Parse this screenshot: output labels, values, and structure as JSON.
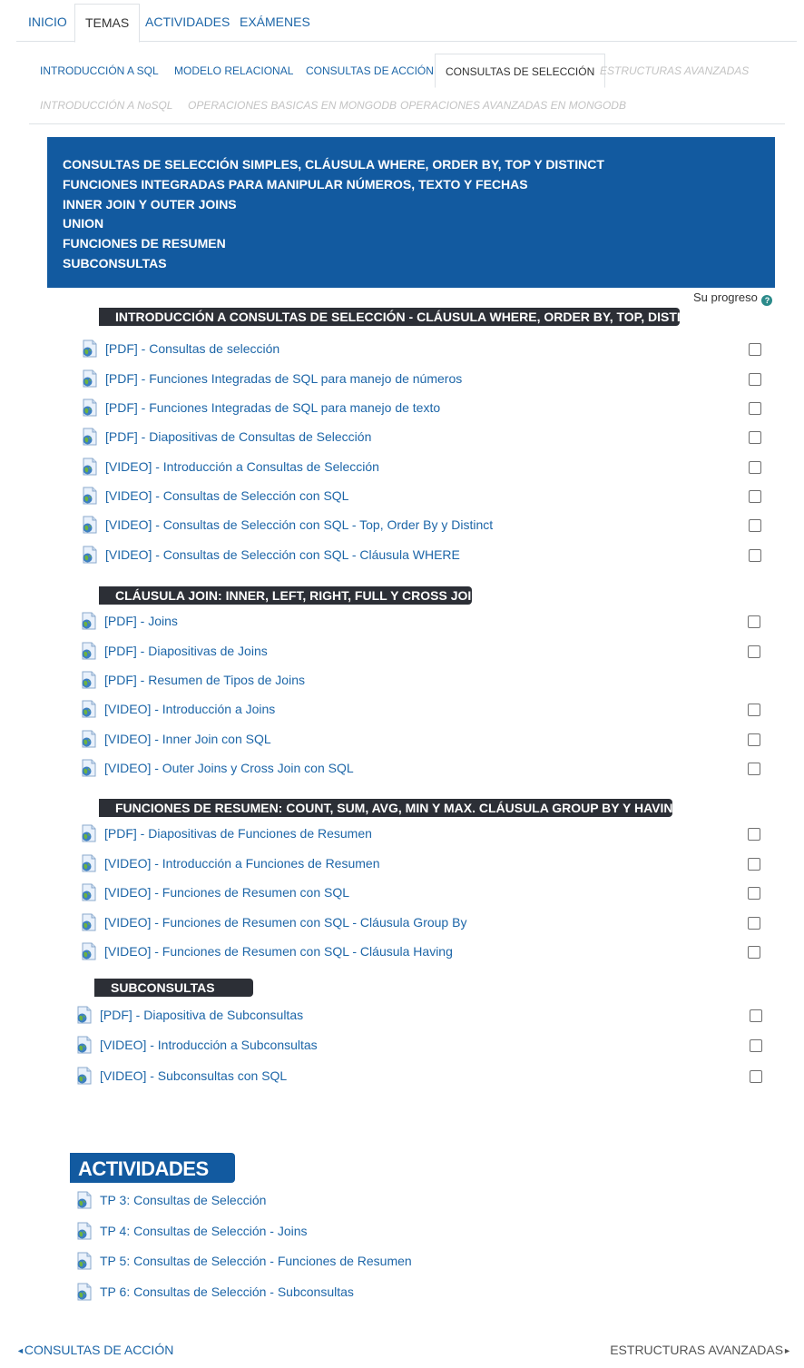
{
  "top_tabs": [
    {
      "label": "INICIO",
      "active": false
    },
    {
      "label": "TEMAS",
      "active": true
    },
    {
      "label": "ACTIVIDADES",
      "active": false
    },
    {
      "label": "EXÁMENES",
      "active": false
    }
  ],
  "sub_tabs": [
    {
      "label": "INTRODUCCIÓN A SQL",
      "state": "link"
    },
    {
      "label": "MODELO RELACIONAL",
      "state": "link"
    },
    {
      "label": "CONSULTAS DE ACCIÓN",
      "state": "link"
    },
    {
      "label": "CONSULTAS DE SELECCIÓN",
      "state": "active"
    },
    {
      "label": "ESTRUCTURAS AVANZADAS",
      "state": "disabled"
    },
    {
      "label": "INTRODUCCIÓN A NoSQL",
      "state": "disabled"
    },
    {
      "label": "OPERACIONES BASICAS EN MONGODB",
      "state": "disabled"
    },
    {
      "label": "OPERACIONES AVANZADAS EN MONGODB",
      "state": "disabled"
    }
  ],
  "summary": [
    "CONSULTAS DE SELECCIÓN SIMPLES, CLÁUSULA WHERE, ORDER BY, TOP Y DISTINCT",
    "FUNCIONES INTEGRADAS PARA MANIPULAR NÚMEROS, TEXTO Y FECHAS",
    "INNER JOIN Y OUTER JOINS",
    "UNION",
    "FUNCIONES DE RESUMEN",
    "SUBCONSULTAS"
  ],
  "progress_label": "Su progreso",
  "help_icon": "?",
  "colors": {
    "link": "#1d66a8",
    "banner": "#125aa0",
    "section_header": "#2c2f36"
  },
  "sections": [
    {
      "title": "INTRODUCCIÓN A CONSULTAS DE SELECCIÓN - CLÁUSULA WHERE, ORDER BY, TOP, DISTINCT",
      "items": [
        {
          "label": "[PDF] - Consultas de selección",
          "checkbox": true
        },
        {
          "label": "[PDF] - Funciones Integradas de SQL para manejo de números",
          "checkbox": true
        },
        {
          "label": "[PDF] - Funciones Integradas de SQL para manejo de texto",
          "checkbox": true
        },
        {
          "label": "[PDF] - Diapositivas de Consultas de Selección",
          "checkbox": true
        },
        {
          "label": "[VIDEO] - Introducción a Consultas de Selección",
          "checkbox": true
        },
        {
          "label": "[VIDEO] - Consultas de Selección con SQL",
          "checkbox": true
        },
        {
          "label": "[VIDEO] - Consultas de Selección con SQL - Top, Order By y Distinct",
          "checkbox": true
        },
        {
          "label": "[VIDEO] - Consultas de Selección con SQL - Cláusula WHERE",
          "checkbox": true
        }
      ]
    },
    {
      "title": "CLÁUSULA JOIN: INNER, LEFT, RIGHT, FULL Y CROSS JOIN",
      "items": [
        {
          "label": "[PDF] - Joins",
          "checkbox": true
        },
        {
          "label": "[PDF] - Diapositivas de Joins",
          "checkbox": true
        },
        {
          "label": "[PDF] - Resumen de Tipos de Joins",
          "checkbox": false
        },
        {
          "label": "[VIDEO] - Introducción a Joins",
          "checkbox": true
        },
        {
          "label": "[VIDEO] - Inner Join con SQL",
          "checkbox": true
        },
        {
          "label": "[VIDEO] - Outer Joins y Cross Join con SQL",
          "checkbox": true
        }
      ]
    },
    {
      "title": "FUNCIONES DE RESUMEN: COUNT, SUM, AVG, MIN Y MAX. CLÁUSULA GROUP BY Y HAVING",
      "items": [
        {
          "label": "[PDF] - Diapositivas de Funciones de Resumen",
          "checkbox": true
        },
        {
          "label": "[VIDEO] - Introducción a Funciones de Resumen",
          "checkbox": true
        },
        {
          "label": "[VIDEO] - Funciones de Resumen con SQL",
          "checkbox": true
        },
        {
          "label": "[VIDEO] - Funciones de Resumen con SQL - Cláusula Group By",
          "checkbox": true
        },
        {
          "label": "[VIDEO] - Funciones de Resumen con SQL - Cláusula Having",
          "checkbox": true
        }
      ]
    },
    {
      "title": "SUBCONSULTAS",
      "items": [
        {
          "label": "[PDF] - Diapositiva de Subconsultas",
          "checkbox": true
        },
        {
          "label": "[VIDEO] - Introducción a Subconsultas",
          "checkbox": true
        },
        {
          "label": "[VIDEO] - Subconsultas con SQL",
          "checkbox": true
        }
      ]
    }
  ],
  "actividades": {
    "title": "ACTIVIDADES",
    "items": [
      "TP 3: Consultas de Selección",
      "TP 4: Consultas de Selección - Joins",
      "TP 5: Consultas de Selección - Funciones de Resumen",
      "TP 6: Consultas de Selección - Subconsultas"
    ]
  },
  "bottom_nav": {
    "prev_label": "CONSULTAS DE ACCIÓN",
    "next_label": "ESTRUCTURAS AVANZADAS",
    "prev_arrow": "◄",
    "next_arrow": "►"
  }
}
